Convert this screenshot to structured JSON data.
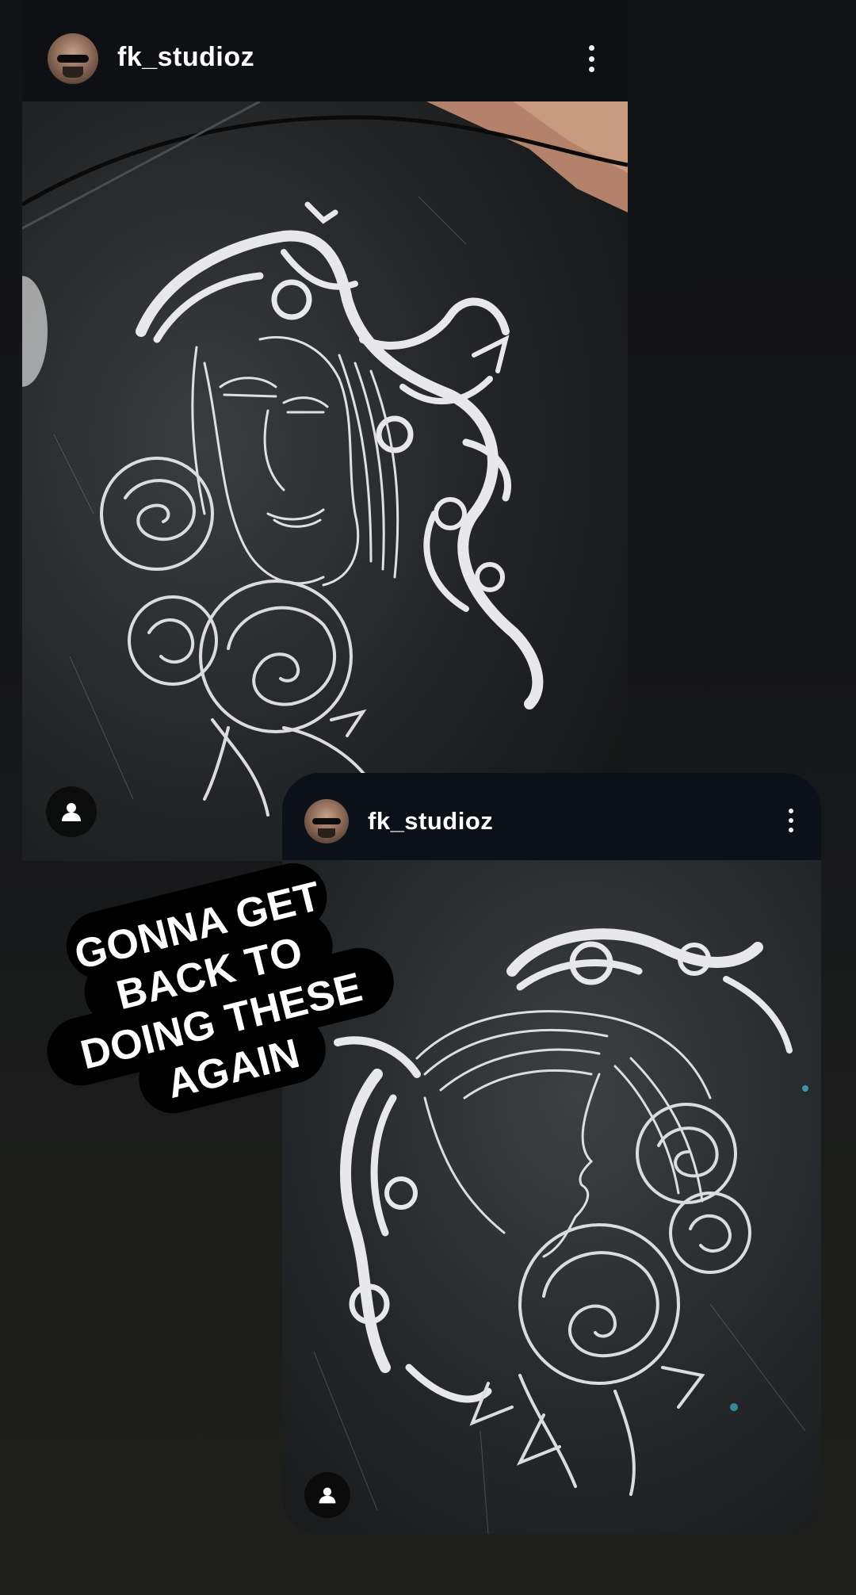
{
  "story": {
    "post_main": {
      "username": "fk_studioz",
      "avatar_icon": "user-avatar-icon",
      "menu_icon": "more-vertical-icon",
      "tag_icon": "person-tag-icon",
      "photo_alt": "engraving of a woman with roses"
    },
    "post_inset": {
      "username": "fk_studioz",
      "avatar_icon": "user-avatar-icon",
      "menu_icon": "more-vertical-icon",
      "tag_icon": "person-tag-icon",
      "photo_alt": "engraving of a woman in profile with roses"
    },
    "caption": {
      "lines": [
        "GONNA GET",
        "BACK TO",
        "DOING THESE",
        "AGAIN"
      ]
    }
  },
  "colors": {
    "background": "#141518",
    "card": "#0e1014",
    "text": "#ffffff",
    "caption_bg": "#000000",
    "engraving": "#e8e8ea"
  }
}
